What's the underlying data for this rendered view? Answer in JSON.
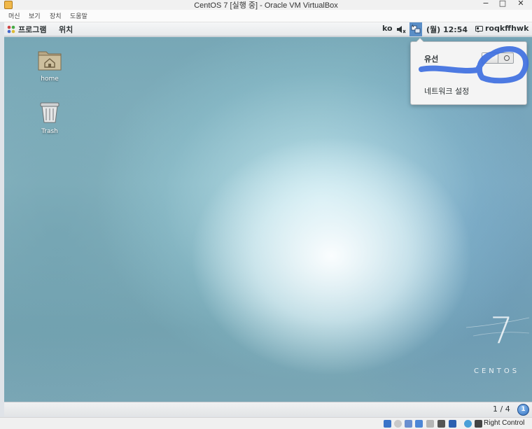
{
  "window": {
    "title": "CentOS 7 [실행 중] - Oracle VM VirtualBox",
    "controls": {
      "minimize": "−",
      "maximize": "□",
      "close": "✕"
    }
  },
  "vbox_menu": [
    "머신",
    "보기",
    "장치",
    "도움말"
  ],
  "gnome_panel": {
    "apps": "프로그램",
    "places": "위치",
    "input_method": "ko",
    "clock": "(월) 12:54",
    "user": "roqkffhwk"
  },
  "desktop": {
    "icons": [
      {
        "label": "home",
        "icon": "home-folder-icon"
      },
      {
        "label": "Trash",
        "icon": "trash-icon"
      }
    ],
    "logo_numeral": "7",
    "logo_word": "CENTOS"
  },
  "network_popover": {
    "wired_label": "유선",
    "wired_switch_state": "off",
    "settings_label": "네트워크 설정"
  },
  "bottom_panel": {
    "workspace_indicator": "1 / 4",
    "workspace_button": "1"
  },
  "vbox_status": {
    "host_key": "Right Control"
  },
  "colors": {
    "annotation": "#3e6fe0",
    "panel_active": "#5a8ec7"
  }
}
